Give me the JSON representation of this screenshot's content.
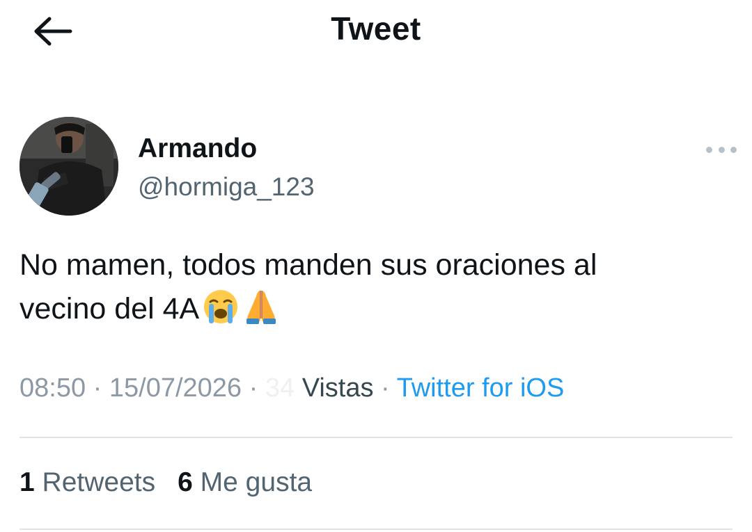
{
  "header": {
    "title": "Tweet",
    "back_icon": "arrow-left-icon"
  },
  "author": {
    "display_name": "Armando",
    "handle": "@hormiga_123",
    "more_icon": "more-horizontal-icon"
  },
  "tweet": {
    "line1": "No mamen, todos manden sus oraciones al",
    "line2": "vecino del 4A",
    "emojis": [
      "loudly-crying-face-icon",
      "folded-hands-icon"
    ]
  },
  "meta": {
    "time": "08:50",
    "separator": "·",
    "date": "15/07/2026",
    "views_count": "34",
    "views_label": "Vistas",
    "source": "Twitter for iOS"
  },
  "stats": {
    "retweets_count": "1",
    "retweets_label": "Retweets",
    "likes_count": "6",
    "likes_label": "Me gusta"
  },
  "colors": {
    "text": "#0f1419",
    "secondary": "#536471",
    "link": "#1d9bf0",
    "divider": "#dfe3e6"
  }
}
